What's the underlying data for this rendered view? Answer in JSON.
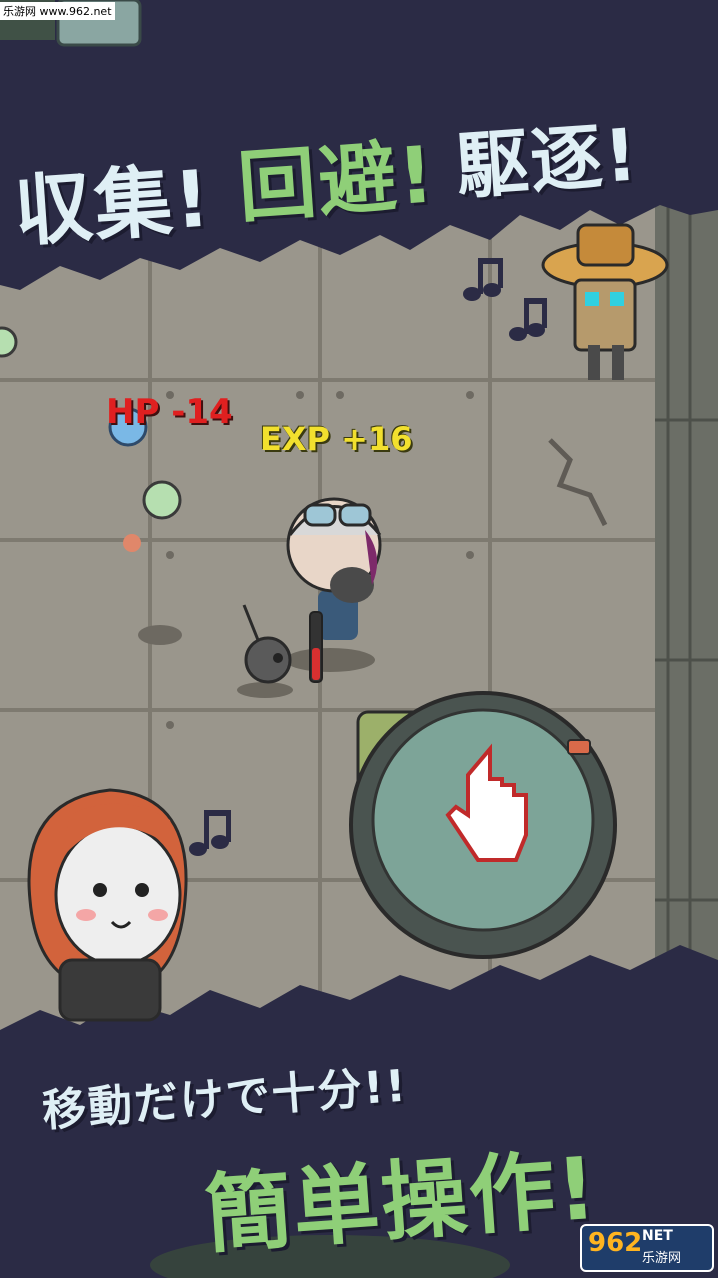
{
  "watermark_top": "乐游网 www.962.net",
  "headline_top": {
    "part1": "収集!",
    "part2": "回避!",
    "part3": "駆逐!"
  },
  "floating_text": {
    "hp": "HP -14",
    "exp": "EXP +16"
  },
  "headline_bottom": {
    "line1": "移動だけで十分!!",
    "line2": "簡単操作!"
  },
  "watermark_bottom": {
    "num": "962",
    "net": "NET",
    "cn": "乐游网"
  },
  "colors": {
    "banner": "#2b2b45",
    "floor": "#9a968c",
    "accent_green": "#8fcf78",
    "hp_red": "#e02020",
    "exp_yellow": "#f2e02e"
  },
  "icons": [
    "music-note-icon",
    "joystick-icon",
    "pointing-hand-icon",
    "radiation-barrel-icon"
  ]
}
